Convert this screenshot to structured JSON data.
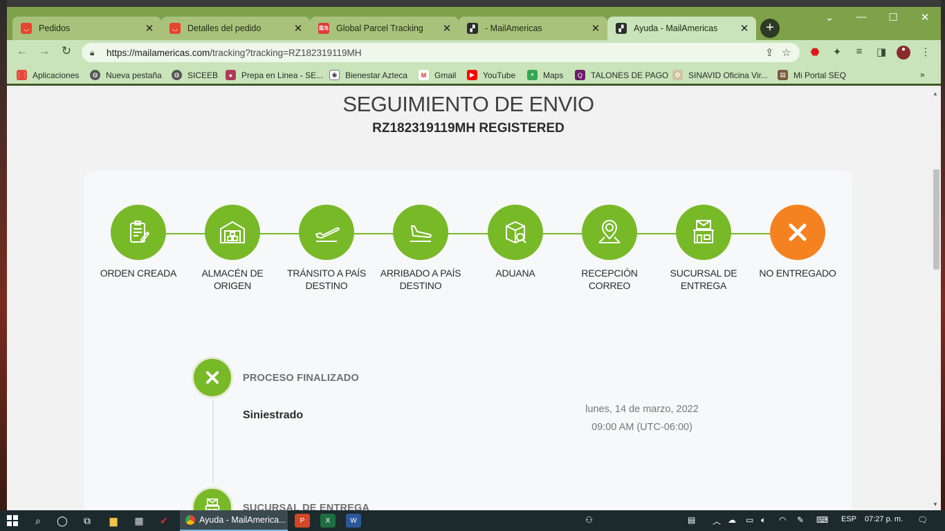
{
  "browser": {
    "tabs": [
      {
        "title": "Pedidos",
        "favicon": "aliexpress-icon"
      },
      {
        "title": "Detalles del pedido",
        "favicon": "aliexpress-icon"
      },
      {
        "title": "Global Parcel Tracking",
        "favicon": "parcel-tracking-icon"
      },
      {
        "title": "- MailAmericas",
        "favicon": "mailamericas-icon"
      },
      {
        "title": "Ayuda - MailAmericas",
        "favicon": "mailamericas-icon"
      }
    ],
    "active_tab": 4,
    "url_host": "https://mailamericas.com",
    "url_path": "/tracking?tracking=RZ182319119MH",
    "bookmarks": [
      "Aplicaciones",
      "Nueva pestaña",
      "SICEEB",
      "Prepa en Linea - SE...",
      "Bienestar Azteca",
      "Gmail",
      "YouTube",
      "Maps",
      "TALONES DE PAGO",
      "SINAVID Oficina Vir...",
      "Mi Portal SEQ"
    ],
    "bookmarks_overflow": "»"
  },
  "page": {
    "heading": "SEGUIMIENTO DE ENVIO",
    "tracking_number": "RZ182319119MH REGISTERED",
    "steps": [
      {
        "line1": "ORDEN CREADA",
        "line2": "",
        "icon": "clipboard-icon",
        "state": "done"
      },
      {
        "line1": "ALMACÉN DE",
        "line2": "ORIGEN",
        "icon": "warehouse-icon",
        "state": "done"
      },
      {
        "line1": "TRÁNSITO A PAÍS",
        "line2": "DESTINO",
        "icon": "plane-takeoff-icon",
        "state": "done"
      },
      {
        "line1": "ARRIBADO A PAÍS",
        "line2": "DESTINO",
        "icon": "plane-landing-icon",
        "state": "done"
      },
      {
        "line1": "ADUANA",
        "line2": "",
        "icon": "customs-box-icon",
        "state": "done"
      },
      {
        "line1": "RECEPCIÓN",
        "line2": "CORREO",
        "icon": "map-pin-icon",
        "state": "done"
      },
      {
        "line1": "SUCURSAL DE",
        "line2": "ENTREGA",
        "icon": "post-office-icon",
        "state": "done"
      },
      {
        "line1": "NO ENTREGADO",
        "line2": "",
        "icon": "x-icon",
        "state": "failed"
      }
    ],
    "timeline": [
      {
        "status": "PROCESO FINALIZADO",
        "event": "Siniestrado",
        "date": "lunes, 14 de marzo, 2022",
        "time": "09:00 AM (UTC-06:00)",
        "icon": "x-icon"
      },
      {
        "status": "SUCURSAL DE ENTREGA",
        "icon": "post-office-icon"
      }
    ]
  },
  "taskbar": {
    "active_app": "Ayuda - MailAmerica...",
    "language": "ESP",
    "clock": "07:27 p. m."
  },
  "colors": {
    "step_done": "#78b928",
    "step_failed": "#f58220",
    "tab_strip": "#7da24a",
    "toolbar": "#c9e4ba"
  }
}
